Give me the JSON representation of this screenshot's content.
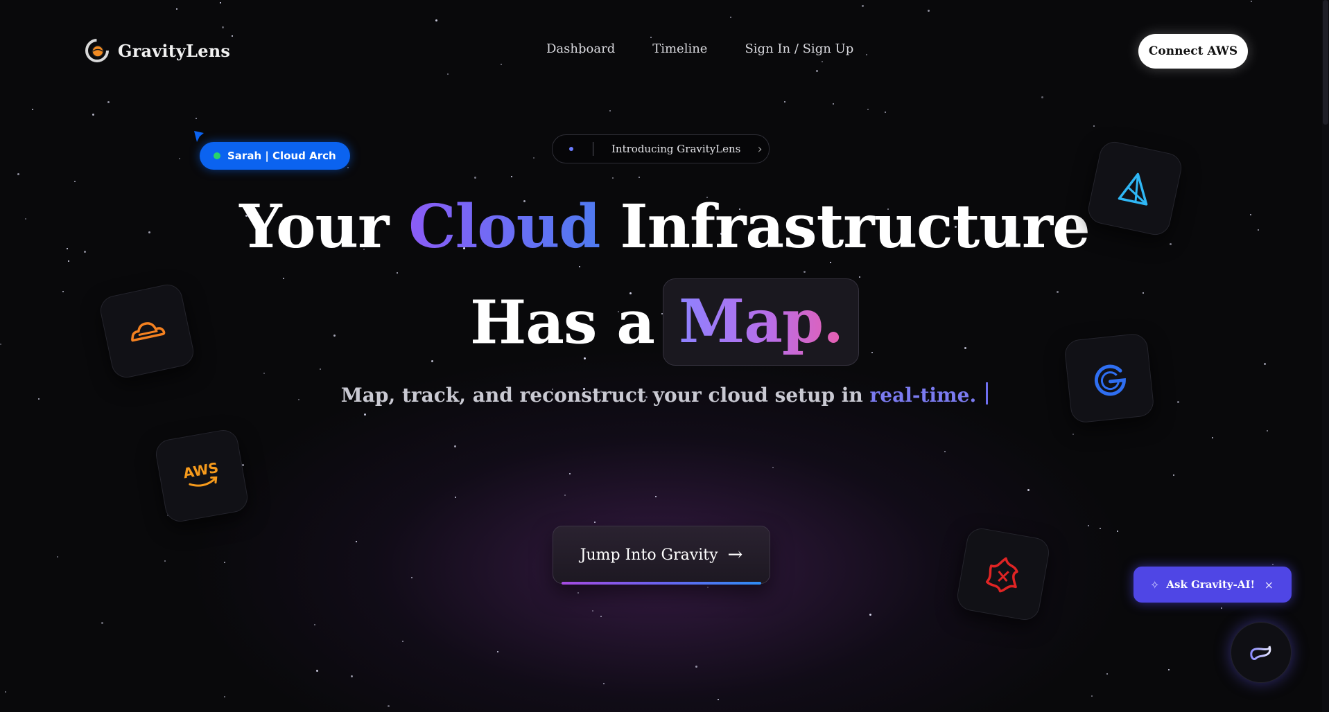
{
  "brand": {
    "name": "GravityLens"
  },
  "nav": {
    "items": [
      "Dashboard",
      "Timeline",
      "Sign In / Sign Up"
    ]
  },
  "header": {
    "connect_label": "Connect AWS"
  },
  "presence": {
    "user_label": "Sarah | Cloud Arch"
  },
  "intro_chip": {
    "label": "Introducing GravityLens"
  },
  "hero": {
    "line1_pre": "Your ",
    "line1_accent": "Cloud",
    "line1_post": " Infrastructure",
    "line2_pre": "Has a",
    "line2_accent": "Map.",
    "subtitle_pre": "Map, track, and reconstruct your cloud setup in ",
    "subtitle_accent": "real-time."
  },
  "cta": {
    "label": "Jump Into Gravity",
    "arrow": "→"
  },
  "tiles": [
    {
      "icon": "cloud-icon",
      "color": "#f48120"
    },
    {
      "icon": "aws-icon",
      "color": "#f79b1c"
    },
    {
      "icon": "triangle-logo-icon",
      "color": "#2fb7f5"
    },
    {
      "icon": "g-logo-icon",
      "color": "#2f6ff2"
    },
    {
      "icon": "star-logo-icon",
      "color": "#e02424"
    }
  ],
  "aws_tile_text": "AWS",
  "assistant": {
    "label": "Ask Gravity-AI!",
    "close": "×",
    "spark": "✧"
  },
  "colors": {
    "background": "#09090b",
    "accent_indigo": "#4f46e5",
    "presence_blue": "#0b63f0",
    "online_green": "#28d36a"
  }
}
